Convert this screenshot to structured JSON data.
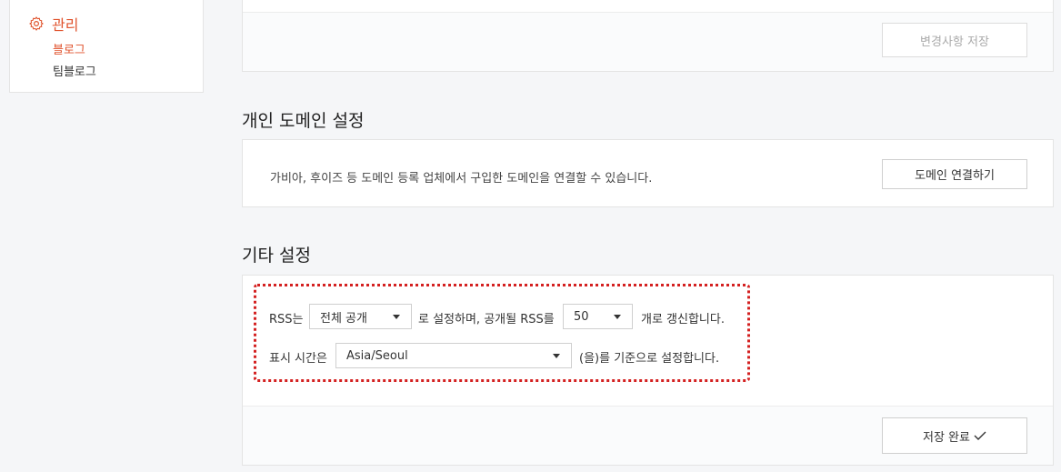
{
  "sidebar": {
    "menu_title": "관리",
    "items": [
      {
        "label": "블로그",
        "active": true
      },
      {
        "label": "팀블로그",
        "active": false
      }
    ]
  },
  "top_panel": {
    "save_changes_label": "변경사항 저장"
  },
  "domain_section": {
    "title": "개인 도메인 설정",
    "description": "가비아, 후이즈 등 도메인 등록 업체에서 구입한 도메인을 연결할 수 있습니다.",
    "connect_button": "도메인 연결하기"
  },
  "etc_section": {
    "title": "기타 설정",
    "rss_prefix": "RSS는",
    "rss_visibility_value": "전체 공개",
    "rss_middle": "로 설정하며, 공개될 RSS를",
    "rss_count_value": "50",
    "rss_suffix": "개로 갱신합니다.",
    "timezone_prefix": "표시 시간은",
    "timezone_value": "Asia/Seoul",
    "timezone_suffix": "(을)를 기준으로 설정합니다.",
    "save_done_label": "저장 완료"
  },
  "colors": {
    "accent": "#e0532d",
    "highlight": "#d42121"
  }
}
